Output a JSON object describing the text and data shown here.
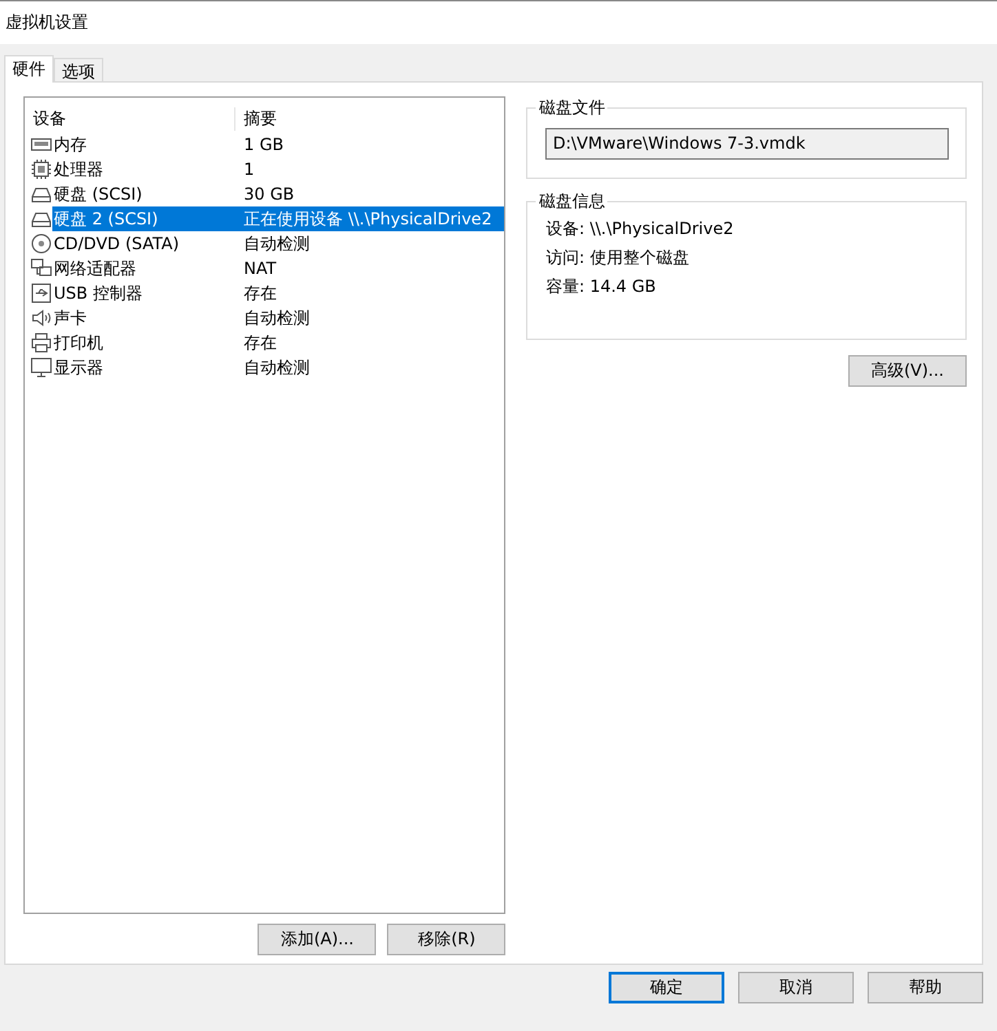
{
  "window": {
    "title": "虚拟机设置"
  },
  "tabs": [
    {
      "label": "硬件",
      "selected": true
    },
    {
      "label": "选项",
      "selected": false
    }
  ],
  "device_table": {
    "columns": [
      "设备",
      "摘要"
    ],
    "rows": [
      {
        "kind": "memory",
        "device": "内存",
        "summary": "1 GB",
        "selected": false
      },
      {
        "kind": "cpu",
        "device": "处理器",
        "summary": "1",
        "selected": false
      },
      {
        "kind": "disk",
        "device": "硬盘 (SCSI)",
        "summary": "30 GB",
        "selected": false
      },
      {
        "kind": "disk",
        "device": "硬盘 2 (SCSI)",
        "summary": "正在使用设备 \\\\.\\PhysicalDrive2",
        "selected": true
      },
      {
        "kind": "cdrom",
        "device": "CD/DVD (SATA)",
        "summary": "自动检测",
        "selected": false
      },
      {
        "kind": "network",
        "device": "网络适配器",
        "summary": "NAT",
        "selected": false
      },
      {
        "kind": "usb",
        "device": "USB 控制器",
        "summary": "存在",
        "selected": false
      },
      {
        "kind": "sound",
        "device": "声卡",
        "summary": "自动检测",
        "selected": false
      },
      {
        "kind": "printer",
        "device": "打印机",
        "summary": "存在",
        "selected": false
      },
      {
        "kind": "display",
        "device": "显示器",
        "summary": "自动检测",
        "selected": false
      }
    ]
  },
  "list_buttons": [
    "添加(A)...",
    "移除(R)"
  ],
  "disk_file": {
    "title": "磁盘文件",
    "value": "D:\\VMware\\Windows 7-3.vmdk"
  },
  "disk_info": {
    "title": "磁盘信息",
    "lines": [
      "设备: \\\\.\\PhysicalDrive2",
      "访问: 使用整个磁盘",
      "容量: 14.4 GB"
    ]
  },
  "advanced_button": "高级(V)...",
  "dialog_buttons": [
    {
      "label": "确定",
      "default": true
    },
    {
      "label": "取消",
      "default": false
    },
    {
      "label": "帮助",
      "default": false
    }
  ]
}
